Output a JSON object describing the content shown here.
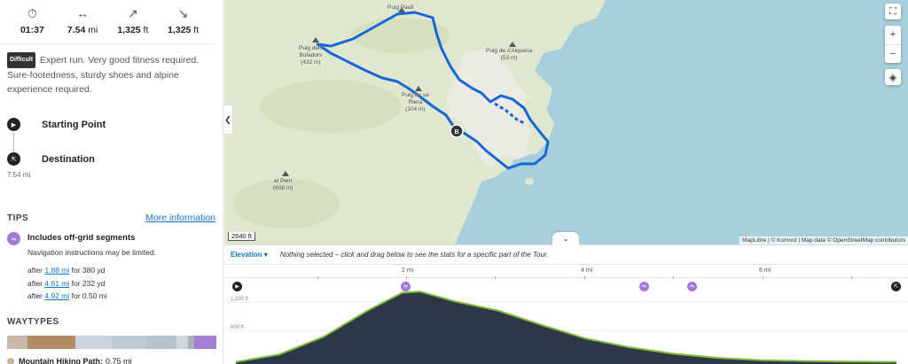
{
  "stats": {
    "duration": {
      "icon": "stopwatch-icon",
      "value": "01:37",
      "unit": ""
    },
    "distance": {
      "icon": "horizontal-arrows-icon",
      "value": "7.54",
      "unit": " mi"
    },
    "ascent": {
      "icon": "arrow-up-right-icon",
      "value": "1,325",
      "unit": " ft"
    },
    "descent": {
      "icon": "arrow-down-right-icon",
      "value": "1,325",
      "unit": " ft"
    }
  },
  "difficulty": {
    "badge": "Difficult",
    "text": "Expert run. Very good fitness required. Sure-footedness, sturdy shoes and alpine experience required."
  },
  "waypoints": {
    "start": {
      "label": "Starting Point",
      "icon": "play-icon"
    },
    "destination": {
      "label": "Destination",
      "icon": "finish-flag-icon",
      "distance": "7.54 mi"
    }
  },
  "tips": {
    "heading": "TIPS",
    "more_link": "More information",
    "title": "Includes off-grid segments",
    "subtitle": "Navigation instructions may be limited.",
    "rows": [
      {
        "prefix": "after ",
        "link": "1.88 mi",
        "suffix": " for 380 yd"
      },
      {
        "prefix": "after ",
        "link": "4.61 mi",
        "suffix": " for 232 yd"
      },
      {
        "prefix": "after ",
        "link": "4.92 mi",
        "suffix": " for 0.50 mi"
      }
    ]
  },
  "waytypes": {
    "heading": "WAYTYPES",
    "segments": [
      {
        "color": "#c9b8ab",
        "share": 0.1
      },
      {
        "color": "#b18a66",
        "share": 0.24
      },
      {
        "color": "#cbd4de",
        "share": 0.18
      },
      {
        "color": "#bfcad4",
        "share": 0.17
      },
      {
        "color": "#b6c3cc",
        "share": 0.15
      },
      {
        "color": "#cfd8df",
        "share": 0.06
      },
      {
        "color": "#a3b4bd",
        "share": 0.03
      },
      {
        "color": "#a37fd8",
        "share": 0.11
      }
    ],
    "first": {
      "name": "Mountain Hiking Path:",
      "value": "0.75 mi"
    }
  },
  "map": {
    "labels": {
      "puig_pauli": "Puig Pauli",
      "puig_alqueria": "Puig de s'Alqueria\n(53 m)",
      "puig_bufadors": "Puig dels\nBufadors\n(432 m)",
      "riera": "Puig de sa\nRiera\n(104 m)",
      "el_peni": "el Pení\n(608 m)"
    },
    "marker_b": "B",
    "scale": "2640 ft",
    "attribution": "MapLibre | © Komoot | Map data © OpenStreetMap contributors",
    "colors": {
      "land": "#dfe8cf",
      "water": "#a7cfdc",
      "route": "#1766d6"
    }
  },
  "elevation": {
    "tab": "Elevation",
    "message": "Nothing selected – click and drag below to see the stats for a specific part of the Tour.",
    "axis_labels": [
      "2 mi",
      "4 mi",
      "6 mi"
    ],
    "y_labels": [
      "1,200 ft",
      "600 ft"
    ],
    "fill": "#2e3747",
    "profile_miles": [
      0,
      0.5,
      1,
      1.5,
      1.9,
      2.1,
      2.5,
      3,
      3.5,
      4,
      4.5,
      5,
      5.5,
      6,
      6.5,
      7,
      7.54
    ],
    "profile_ft": [
      20,
      150,
      450,
      900,
      1210,
      1230,
      1060,
      900,
      650,
      420,
      270,
      160,
      90,
      50,
      35,
      25,
      20
    ]
  }
}
